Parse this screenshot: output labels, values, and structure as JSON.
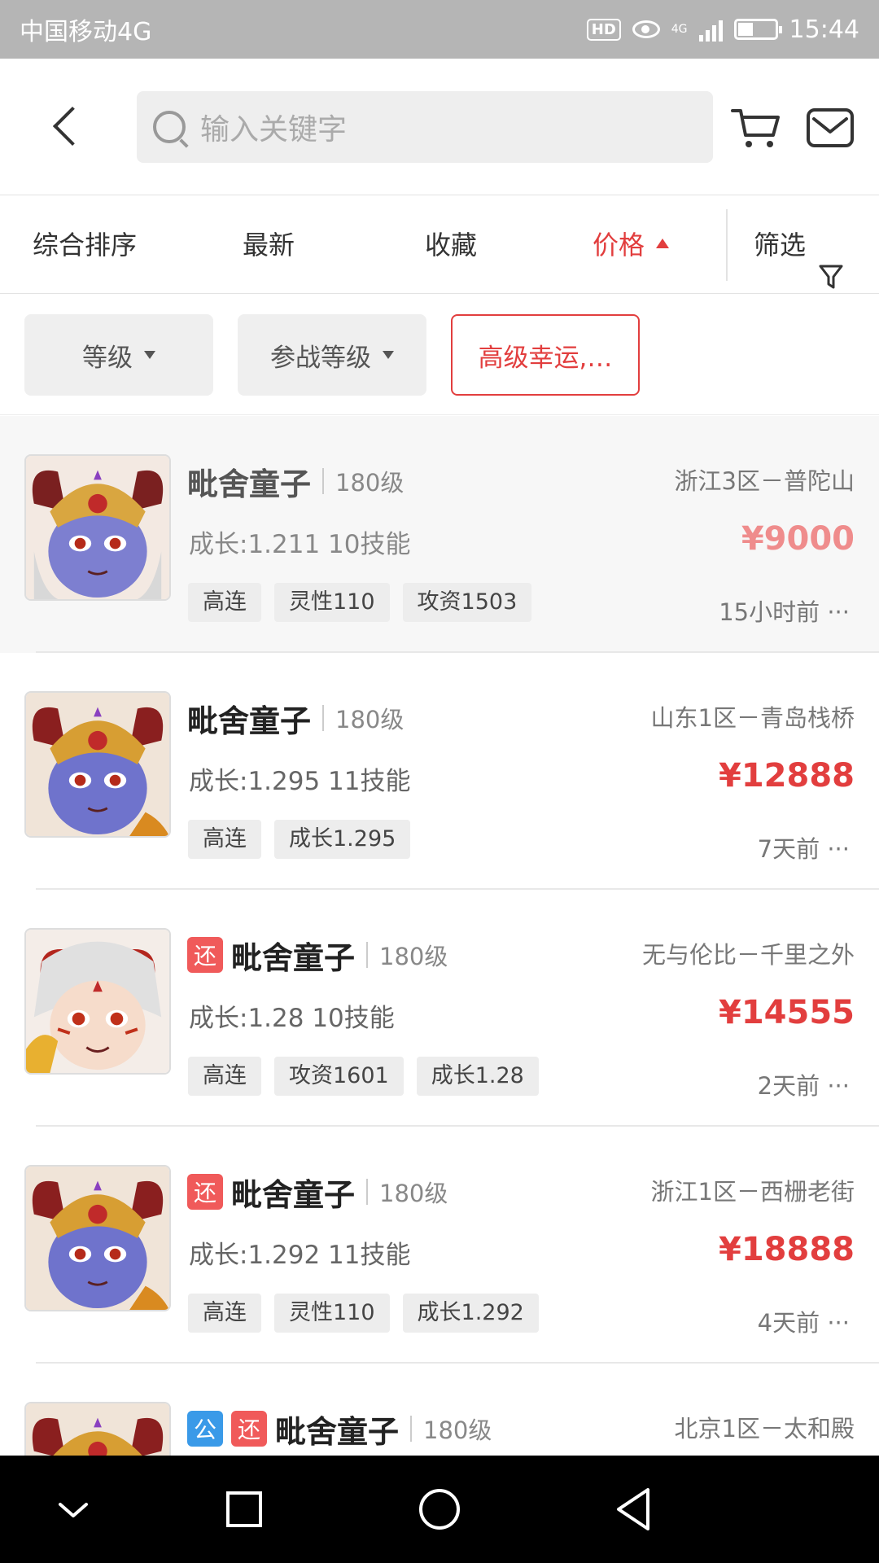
{
  "status_bar": {
    "carrier": "中国移动4G",
    "hd": "HD",
    "network": "4G",
    "time": "15:44"
  },
  "header": {
    "search_placeholder": "输入关键字"
  },
  "sort_bar": {
    "items": [
      "综合排序",
      "最新",
      "收藏",
      "价格"
    ],
    "active_index": 3,
    "filter_label": "筛选"
  },
  "filters": {
    "chips": [
      "等级",
      "参战等级",
      "高级幸运,…"
    ]
  },
  "listings": [
    {
      "badges": [],
      "name": "毗舍童子",
      "level": "180级",
      "server": "浙江3区－普陀山",
      "growth": "成长:1.211 10技能",
      "price": "¥9000",
      "tags": [
        "高连",
        "灵性110",
        "攻资1503"
      ],
      "time": "15小时前 ···"
    },
    {
      "badges": [],
      "name": "毗舍童子",
      "level": "180级",
      "server": "山东1区－青岛栈桥",
      "growth": "成长:1.295 11技能",
      "price": "¥12888",
      "tags": [
        "高连",
        "成长1.295"
      ],
      "time": "7天前 ···"
    },
    {
      "badges": [
        "还"
      ],
      "name": "毗舍童子",
      "level": "180级",
      "server": "无与伦比－千里之外",
      "growth": "成长:1.28 10技能",
      "price": "¥14555",
      "tags": [
        "高连",
        "攻资1601",
        "成长1.28"
      ],
      "time": "2天前 ···"
    },
    {
      "badges": [
        "还"
      ],
      "name": "毗舍童子",
      "level": "180级",
      "server": "浙江1区－西栅老街",
      "growth": "成长:1.292 11技能",
      "price": "¥18888",
      "tags": [
        "高连",
        "灵性110",
        "成长1.292"
      ],
      "time": "4天前 ···"
    },
    {
      "badges": [
        "公",
        "还"
      ],
      "name": "毗舍童子",
      "level": "180级",
      "server": "北京1区－太和殿"
    }
  ],
  "colors": {
    "accent": "#e23e3e",
    "badge_huan": "#f05a5a",
    "badge_gong": "#3a9ae8"
  }
}
